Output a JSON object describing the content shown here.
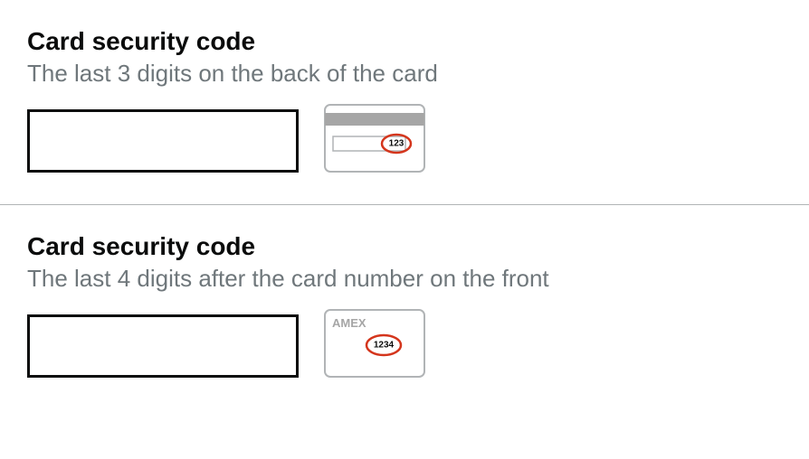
{
  "section1": {
    "label": "Card security code",
    "hint": "The last 3 digits on the back of the card",
    "inputValue": "",
    "illustration": {
      "example_digits": "123"
    }
  },
  "section2": {
    "label": "Card security code",
    "hint": "The last 4 digits after the card number on the front",
    "inputValue": "",
    "illustration": {
      "brand": "AMEX",
      "example_digits": "1234"
    }
  }
}
